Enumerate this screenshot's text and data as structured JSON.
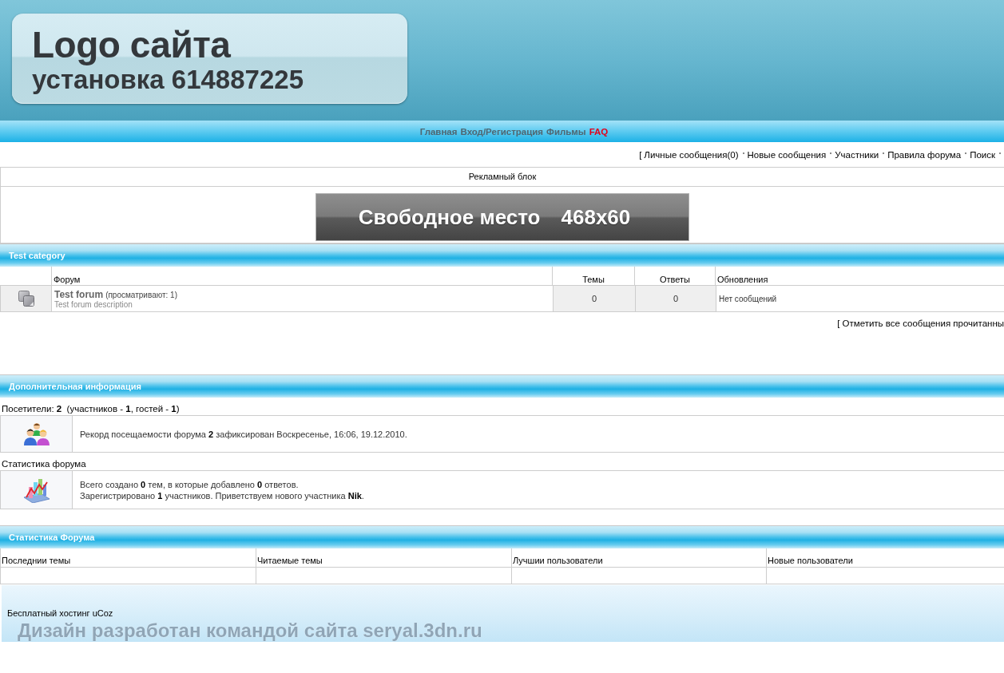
{
  "header": {
    "logo_title": "Logo сайта",
    "logo_subtitle": "установка 614887225"
  },
  "nav": [
    {
      "label": "Главная",
      "selected": false
    },
    {
      "label": "Вход/Регистрация",
      "selected": false
    },
    {
      "label": "Фильмы",
      "selected": false
    },
    {
      "label": "FAQ",
      "selected": true
    }
  ],
  "user_links": {
    "bracket": "[",
    "items": [
      "Личные сообщения(0)",
      "Новые сообщения",
      "Участники",
      "Правила форума",
      "Поиск"
    ]
  },
  "ad_block": {
    "title": "Рекламный блок",
    "banner_text": "Свободное место",
    "banner_size": "468x60"
  },
  "category": {
    "title": "Test category",
    "columns": [
      "Форум",
      "Темы",
      "Ответы",
      "Обновления"
    ],
    "forums": [
      {
        "name": "Test forum",
        "viewers": "(просматривают: 1)",
        "description": "Test forum description",
        "topics": "0",
        "replies": "0",
        "last_update": "Нет сообщений"
      }
    ]
  },
  "mark_read": {
    "bracket": "[",
    "label": "Отметить все сообщения прочитанны"
  },
  "info": {
    "title": "Дополнительная информация",
    "sections": [
      {
        "kind": "visitors",
        "label": "Посетители: **2**  (участников - **1**, гостей - **1**)",
        "lines": [
          "Рекорд посещаемости форума **2** зафиксирован Воскресенье, 16:06, 19.12.2010."
        ]
      },
      {
        "kind": "stats",
        "label": "Статистика форума",
        "lines": [
          "Всего создано **0** тем, в которые добавлено **0** ответов.",
          "Зарегистрировано **1** участников. Приветствуем нового участника **Nik**."
        ]
      }
    ]
  },
  "stats": {
    "title": "Статистика Форума",
    "columns": [
      "Последнии темы",
      "Читаемые темы",
      "Лучшии пользователи",
      "Новые пользователи"
    ]
  },
  "footer": {
    "hosting": "Бесплатный хостинг uCoz",
    "credit": "Дизайн разработан командой сайта seryal.3dn.ru"
  }
}
